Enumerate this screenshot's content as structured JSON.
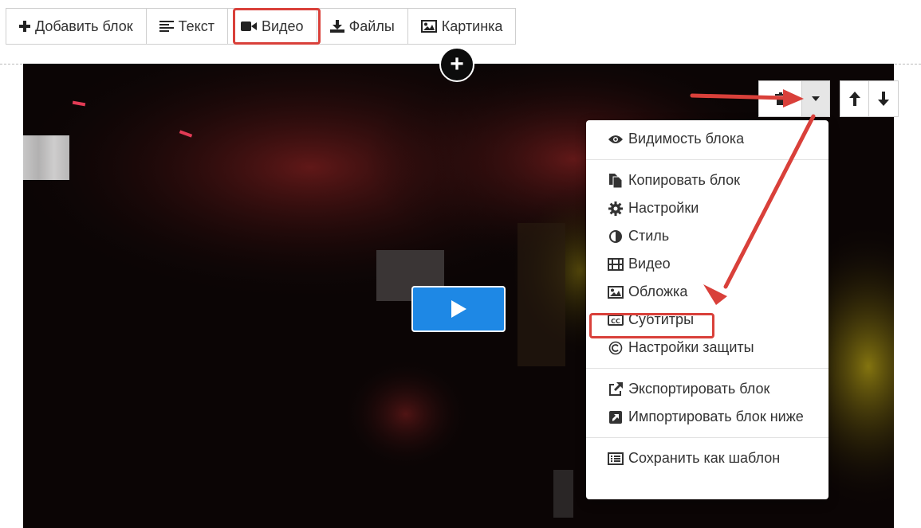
{
  "toolbar": {
    "items": [
      {
        "label": "Добавить блок",
        "icon": "plus-icon"
      },
      {
        "label": "Текст",
        "icon": "align-left-icon"
      },
      {
        "label": "Видео",
        "icon": "video-camera-icon"
      },
      {
        "label": "Файлы",
        "icon": "download-icon"
      },
      {
        "label": "Картинка",
        "icon": "image-icon"
      }
    ]
  },
  "block_controls": {
    "delete_icon": "trash-icon",
    "dropdown_icon": "caret-down-icon",
    "move_up_icon": "arrow-up-icon",
    "move_down_icon": "arrow-down-icon"
  },
  "menu": {
    "visibility": "Видимость блока",
    "copy": "Копировать блок",
    "settings": "Настройки",
    "style": "Стиль",
    "video": "Видео",
    "cover": "Обложка",
    "subtitles": "Субтитры",
    "protection": "Настройки защиты",
    "export": "Экспортировать блок",
    "import": "Импортировать блок ниже",
    "save_template": "Сохранить как шаблон"
  },
  "colors": {
    "highlight": "#d9403a",
    "play": "#1e88e5",
    "video_bg": "#0b0505"
  }
}
